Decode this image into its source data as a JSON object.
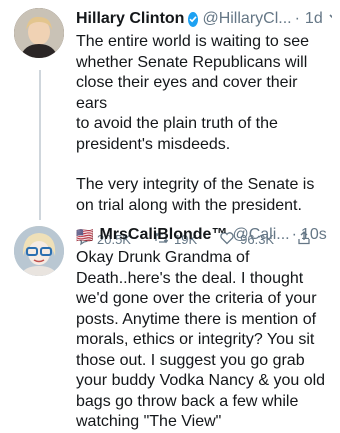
{
  "tweet1": {
    "name": "Hillary Clinton",
    "handle": "@HillaryCl...",
    "dot": "·",
    "time": "1d",
    "text_lines": [
      "The entire world is waiting to see",
      "whether Senate Republicans will",
      "close their eyes and cover their ears",
      "to avoid the plain truth of the",
      "president's misdeeds."
    ],
    "text_lines2": [
      "The very integrity of the Senate is",
      "on trial along with the president."
    ],
    "replies": "20.5K",
    "retweets": "19K",
    "likes": "96.3K"
  },
  "tweet2": {
    "flag": "🇺🇸",
    "name": "MrsCaliBlonde™",
    "handle": "@Cali...",
    "dot": "·",
    "time": "10s",
    "text_lines": [
      "Okay Drunk Grandma of",
      "Death..here's the deal. I thought",
      "we'd gone over the criteria of your",
      "posts. Anytime there is mention of",
      "morals, ethics or integrity? You sit",
      "those out. I suggest you go grab",
      "your buddy Vodka Nancy & you old",
      "bags go throw back a few while",
      "watching \"The View\""
    ]
  },
  "icons": {
    "verified": "verified-badge-icon",
    "chevron": "chevron-down-icon",
    "reply": "reply-icon",
    "retweet": "retweet-icon",
    "like": "heart-icon",
    "share": "share-icon"
  },
  "colors": {
    "accent": "#1da1f2",
    "muted": "#657786",
    "text": "#14171a"
  }
}
